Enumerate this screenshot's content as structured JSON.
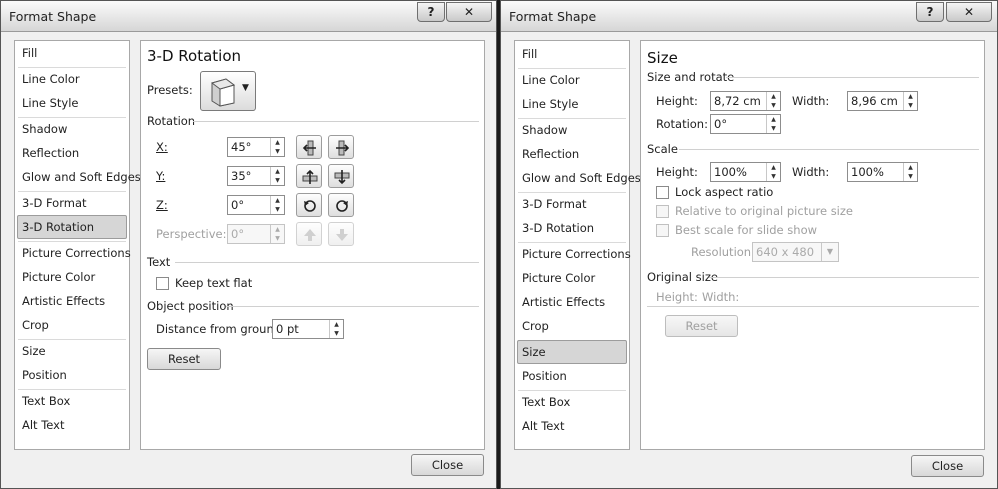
{
  "left_dialog": {
    "title": "Format Shape",
    "help_label": "?",
    "close_x_label": "✕",
    "nav": {
      "fill": "Fill",
      "line_color": "Line Color",
      "line_style": "Line Style",
      "shadow": "Shadow",
      "reflection": "Reflection",
      "glow": "Glow and Soft Edges",
      "format_3d": "3-D Format",
      "rotation_3d": "3-D Rotation",
      "pic_corr": "Picture Corrections",
      "pic_color": "Picture Color",
      "artistic": "Artistic Effects",
      "crop": "Crop",
      "size": "Size",
      "position": "Position",
      "text_box": "Text Box",
      "alt_text": "Alt Text"
    },
    "pane_title": "3-D Rotation",
    "presets_label": "Presets:",
    "rotation_group": "Rotation",
    "x_label": "X:",
    "x_value": "45°",
    "y_label": "Y:",
    "y_value": "35°",
    "z_label": "Z:",
    "z_value": "0°",
    "perspective_label": "Perspective:",
    "perspective_value": "0°",
    "text_group": "Text",
    "keep_flat_label": "Keep text flat",
    "keep_flat_checked": false,
    "objpos_group": "Object position",
    "distance_label": "Distance from ground:",
    "distance_value": "0 pt",
    "reset_label": "Reset",
    "close_label": "Close",
    "icons": [
      "left-rotate-icon",
      "right-rotate-icon",
      "up-rotate-icon",
      "down-rotate-icon",
      "counterclockwise-icon",
      "clockwise-icon",
      "increase-perspective-icon",
      "decrease-perspective-icon"
    ]
  },
  "right_dialog": {
    "title": "Format Shape",
    "help_label": "?",
    "close_x_label": "✕",
    "nav": {
      "fill": "Fill",
      "line_color": "Line Color",
      "line_style": "Line Style",
      "shadow": "Shadow",
      "reflection": "Reflection",
      "glow": "Glow and Soft Edges",
      "format_3d": "3-D Format",
      "rotation_3d": "3-D Rotation",
      "pic_corr": "Picture Corrections",
      "pic_color": "Picture Color",
      "artistic": "Artistic Effects",
      "crop": "Crop",
      "size": "Size",
      "position": "Position",
      "text_box": "Text Box",
      "alt_text": "Alt Text"
    },
    "pane_title": "Size",
    "size_rotate_group": "Size and rotate",
    "height_label": "Height:",
    "height_value": "8,72 cm",
    "width_label": "Width:",
    "width_value": "8,96 cm",
    "rotation_label": "Rotation:",
    "rotation_value": "0°",
    "scale_group": "Scale",
    "scale_height_label": "Height:",
    "scale_height_value": "100%",
    "scale_width_label": "Width:",
    "scale_width_value": "100%",
    "lock_aspect_label": "Lock aspect ratio",
    "relative_label": "Relative to original picture size",
    "best_scale_label": "Best scale for slide show",
    "resolution_label": "Resolution",
    "resolution_value": "640 x 480",
    "original_group": "Original size",
    "original_height_label": "Height:",
    "original_width_label": "Width:",
    "reset_label": "Reset",
    "close_label": "Close"
  },
  "colors": {
    "window_bg": "#f0f0f0",
    "pane_bg": "#ffffff",
    "selected_nav": "#d6d6d6",
    "disabled_text": "#a0a0a0"
  }
}
